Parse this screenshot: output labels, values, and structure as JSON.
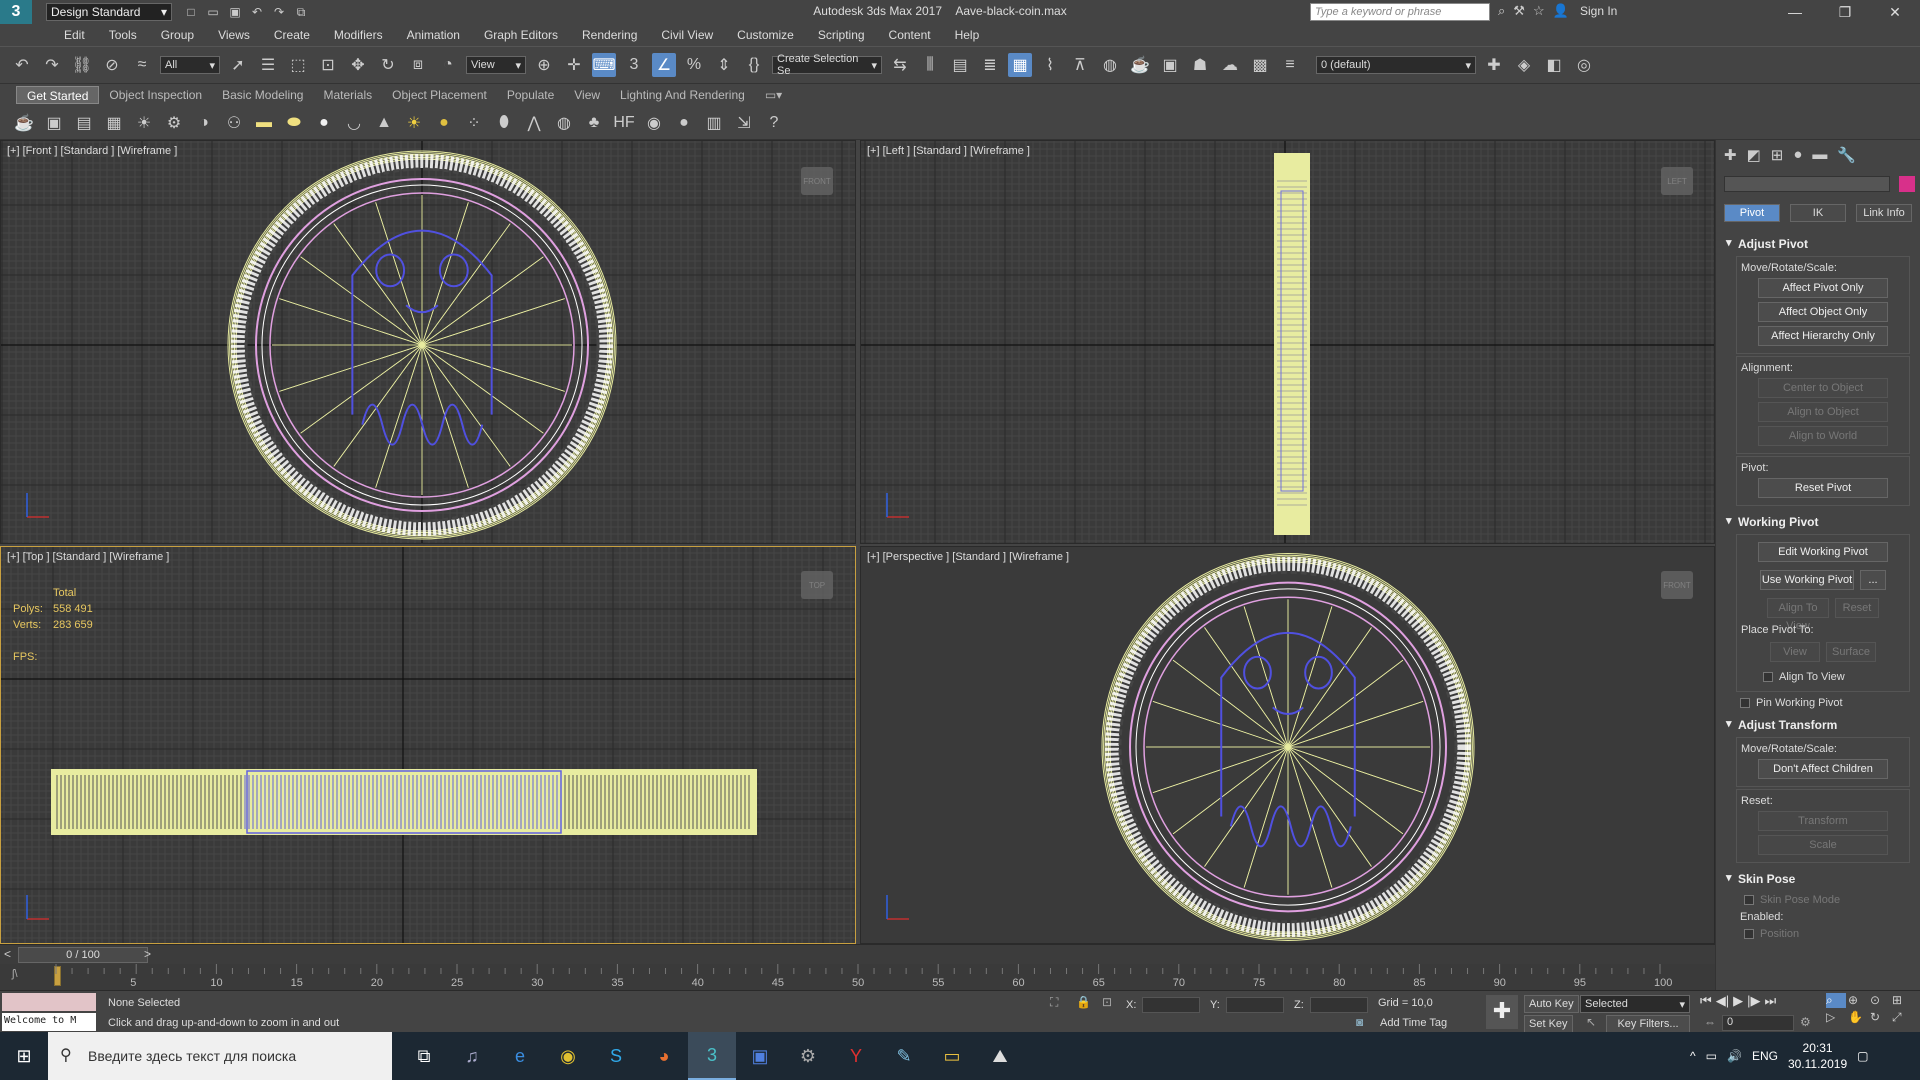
{
  "title_bar": {
    "workspace": "Design Standard",
    "app_title": "Autodesk 3ds Max 2017",
    "file_name": "Aave-black-coin.max",
    "search_placeholder": "Type a keyword or phrase",
    "sign_in": "Sign In"
  },
  "menu": [
    "Edit",
    "Tools",
    "Group",
    "Views",
    "Create",
    "Modifiers",
    "Animation",
    "Graph Editors",
    "Rendering",
    "Civil View",
    "Customize",
    "Scripting",
    "Content",
    "Help"
  ],
  "toolbar": {
    "selection_filter": "All",
    "ref_coord": "View",
    "named_selection": "Create Selection Se",
    "layer": "0 (default)"
  },
  "ribbon_tabs": [
    "Get Started",
    "Object Inspection",
    "Basic Modeling",
    "Materials",
    "Object Placement",
    "Populate",
    "View",
    "Lighting And Rendering"
  ],
  "viewports": {
    "front": {
      "label": "[+] [Front ] [Standard ] [Wireframe ]",
      "cube": "FRONT"
    },
    "left": {
      "label": "[+] [Left ] [Standard ] [Wireframe ]",
      "cube": "LEFT"
    },
    "top": {
      "label": "[+] [Top ] [Standard ] [Wireframe ]",
      "cube": "TOP"
    },
    "perspective": {
      "label": "[+] [Perspective ] [Standard ] [Wireframe ]",
      "cube": "FRONT"
    }
  },
  "stats": {
    "total": "Total",
    "polys_label": "Polys:",
    "polys": "558 491",
    "verts_label": "Verts:",
    "verts": "283 659",
    "fps_label": "FPS:"
  },
  "command_panel": {
    "subtabs": [
      "Pivot",
      "IK",
      "Link Info"
    ],
    "adjust_pivot": {
      "title": "Adjust Pivot",
      "mrs_label": "Move/Rotate/Scale:",
      "buttons": [
        "Affect Pivot Only",
        "Affect Object Only",
        "Affect Hierarchy Only"
      ],
      "alignment_label": "Alignment:",
      "align_buttons": [
        "Center to Object",
        "Align to Object",
        "Align to World"
      ],
      "pivot_label": "Pivot:",
      "reset_pivot": "Reset Pivot"
    },
    "working_pivot": {
      "title": "Working Pivot",
      "edit": "Edit Working Pivot",
      "use": "Use Working Pivot",
      "use_extra": "...",
      "align_to_view": "Align To View",
      "reset": "Reset",
      "place_label": "Place Pivot To:",
      "view": "View",
      "surface": "Surface",
      "align_chk": "Align To View",
      "pin": "Pin Working Pivot"
    },
    "adjust_transform": {
      "title": "Adjust Transform",
      "mrs_label": "Move/Rotate/Scale:",
      "dont_affect": "Don't Affect Children",
      "reset_label": "Reset:",
      "transform": "Transform",
      "scale": "Scale"
    },
    "skin_pose": {
      "title": "Skin Pose",
      "mode": "Skin Pose Mode",
      "enabled_label": "Enabled:",
      "position": "Position"
    }
  },
  "timeline": {
    "frame": "0 / 100",
    "ticks": [
      "5",
      "10",
      "15",
      "20",
      "25",
      "30",
      "35",
      "40",
      "45",
      "50",
      "55",
      "60",
      "65",
      "70",
      "75",
      "80",
      "85",
      "90",
      "95",
      "100"
    ]
  },
  "status": {
    "welcome": "Welcome to M",
    "none_selected": "None Selected",
    "prompt": "Click and drag up-and-down to zoom in and out",
    "x": "X:",
    "y": "Y:",
    "z": "Z:",
    "grid": "Grid = 10,0",
    "add_time_tag": "Add Time Tag",
    "auto_key": "Auto Key",
    "set_key": "Set Key",
    "selected": "Selected",
    "key_filters": "Key Filters...",
    "frame_value": "0"
  },
  "taskbar": {
    "search": "Введите здесь текст для поиска",
    "lang": "ENG",
    "time": "20:31",
    "date": "30.11.2019"
  },
  "colors": {
    "accent": "#5a8ac6",
    "wire_yellow": "#e8eca0",
    "wire_pink": "#e0a0e0",
    "wire_blue": "#5050e0",
    "active_border": "#c8a040"
  }
}
